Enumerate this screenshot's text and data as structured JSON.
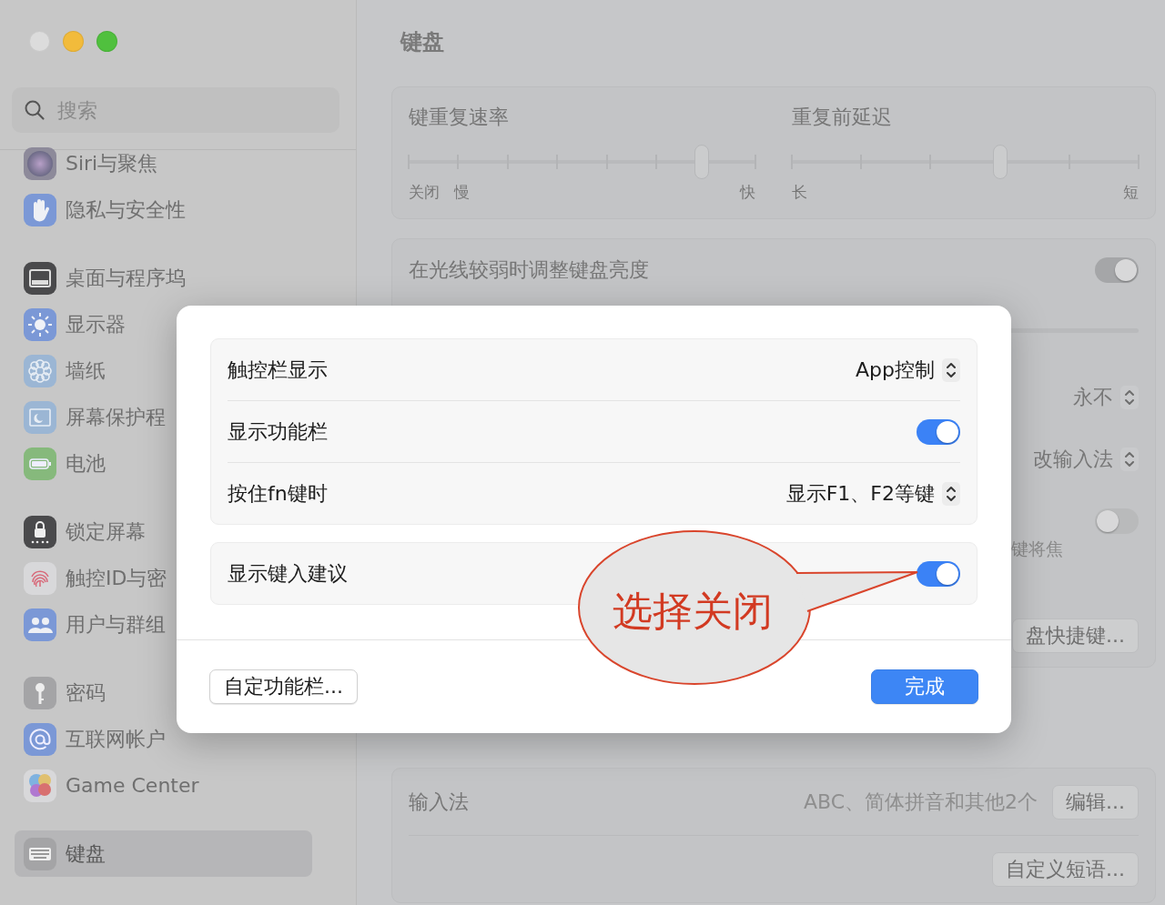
{
  "window": {
    "traffic_lights": [
      {
        "color": "#dcdcdc"
      },
      {
        "color": "#f2bb3b"
      },
      {
        "color": "#50c03e"
      }
    ]
  },
  "sidebar": {
    "search": {
      "placeholder": "搜索"
    },
    "groups": [
      [
        {
          "label": "Siri与聚焦",
          "selected": false
        },
        {
          "label": "隐私与安全性",
          "selected": false
        }
      ],
      [
        {
          "label": "桌面与程序坞",
          "selected": false
        },
        {
          "label": "显示器",
          "selected": false
        },
        {
          "label": "墙纸",
          "selected": false
        },
        {
          "label": "屏幕保护程",
          "selected": false
        },
        {
          "label": "电池",
          "selected": false
        }
      ],
      [
        {
          "label": "锁定屏幕",
          "selected": false
        },
        {
          "label": "触控ID与密",
          "selected": false
        },
        {
          "label": "用户与群组",
          "selected": false
        }
      ],
      [
        {
          "label": "密码",
          "selected": false
        },
        {
          "label": "互联网帐户",
          "selected": false
        },
        {
          "label": "Game Center",
          "selected": false
        }
      ],
      [
        {
          "label": "键盘",
          "selected": true
        }
      ]
    ]
  },
  "main": {
    "title": "键盘",
    "repeat_card": {
      "sliders": [
        {
          "title": "键重复速率",
          "level": 0.845,
          "scale": [
            "关闭",
            "慢",
            "快"
          ]
        },
        {
          "title": "重复前延迟",
          "level": 0.6,
          "scale": [
            "长",
            "短"
          ]
        }
      ]
    },
    "settings_card": {
      "rows": [
        {
          "kind": "toggle",
          "label": "在光线较弱时调整键盘亮度",
          "on": true
        },
        {
          "kind": "track"
        },
        {
          "kind": "popup",
          "value": "永不"
        },
        {
          "kind": "popup",
          "value": "改输入法"
        },
        {
          "kind": "toggle",
          "on": false,
          "note": "键将焦"
        },
        {
          "kind": "button",
          "button": "盘快捷键..."
        }
      ]
    },
    "text_input_card": {
      "rows": [
        {
          "kind": "button",
          "label": "输入法",
          "value": "ABC、简体拼音和其他2个",
          "button": "编辑..."
        },
        {
          "kind": "button",
          "button": "自定义短语..."
        }
      ]
    }
  },
  "dialog": {
    "groups": [
      [
        {
          "kind": "popup",
          "label": "触控栏显示",
          "value": "App控制"
        },
        {
          "kind": "toggle",
          "label": "显示功能栏",
          "on": true
        },
        {
          "kind": "popup",
          "label": "按住fn键时",
          "value": "显示F1、F2等键"
        }
      ],
      [
        {
          "kind": "toggle",
          "label": "显示键入建议",
          "on": true
        }
      ]
    ],
    "buttons": [
      {
        "label": "自定功能栏...",
        "default": false
      },
      {
        "label": "完成",
        "default": true
      }
    ]
  },
  "annotation": {
    "text": "选择关闭"
  }
}
